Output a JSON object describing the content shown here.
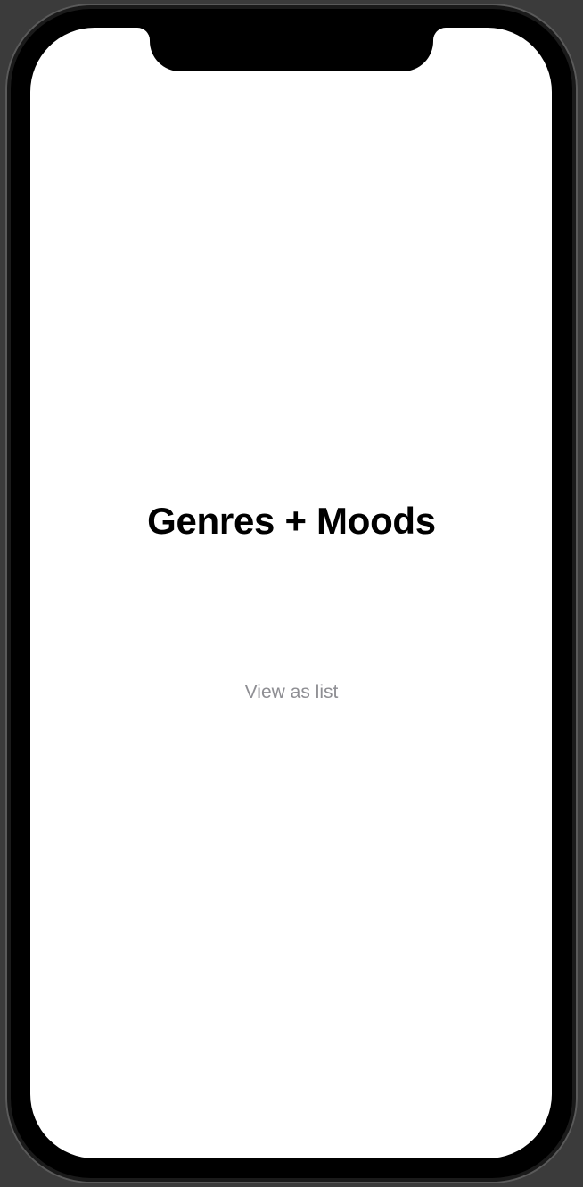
{
  "screen": {
    "title": "Genres + Moods",
    "view_as_list_label": "View as list"
  },
  "colors": {
    "background": "#ffffff",
    "title": "#000000",
    "link": "#8e8e93"
  }
}
